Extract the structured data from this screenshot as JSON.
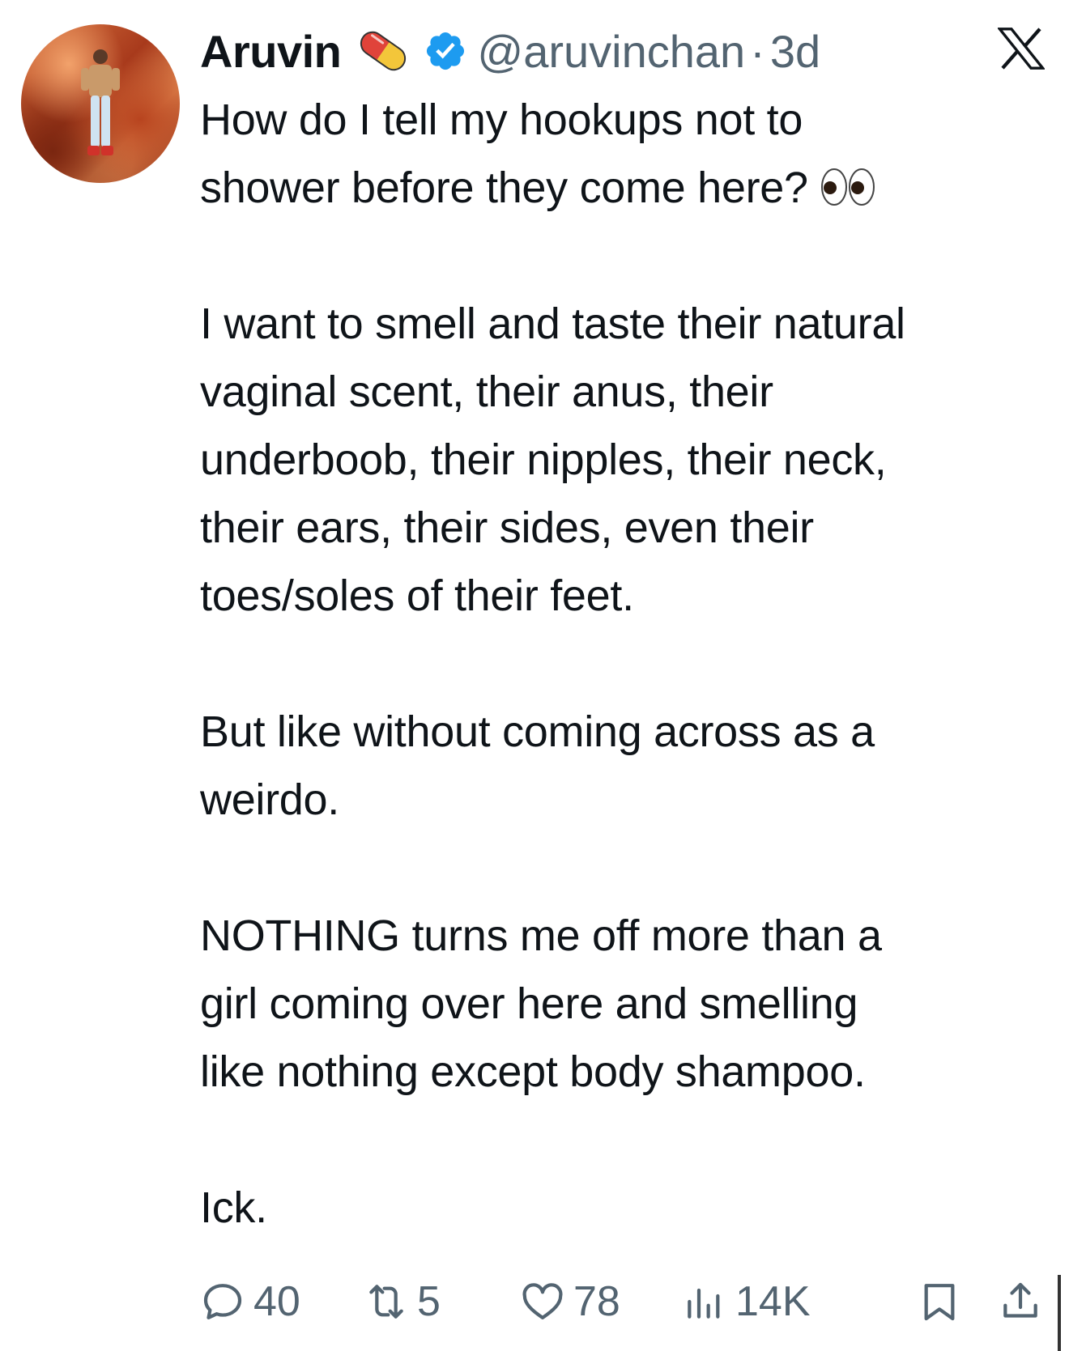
{
  "author": {
    "name": "Aruvin",
    "name_emoji": "pill-emoji",
    "verified_icon": "verified-badge-icon",
    "handle": "@aruvinchan",
    "separator": "·",
    "time": "3d"
  },
  "platform_logo": "x-logo-icon",
  "tweet": {
    "paragraphs": [
      "How do I tell my hookups not to\nshower before they come here?",
      "I want to smell and taste their natural\nvaginal scent, their anus, their\nunderboob, their nipples, their neck,\ntheir ears, their sides, even their\ntoes/soles of their feet.",
      "But like without coming across as a\nweirdo.",
      "NOTHING turns me off more than a\ngirl coming over here and smelling\nlike nothing except body shampoo.",
      "Ick."
    ],
    "first_paragraph_emoji": "eyes-emoji"
  },
  "actions": {
    "replies": "40",
    "reposts": "5",
    "likes": "78",
    "views": "14K"
  },
  "colors": {
    "text": "#0f1419",
    "secondary": "#536471",
    "verified": "#1d9bf0"
  }
}
